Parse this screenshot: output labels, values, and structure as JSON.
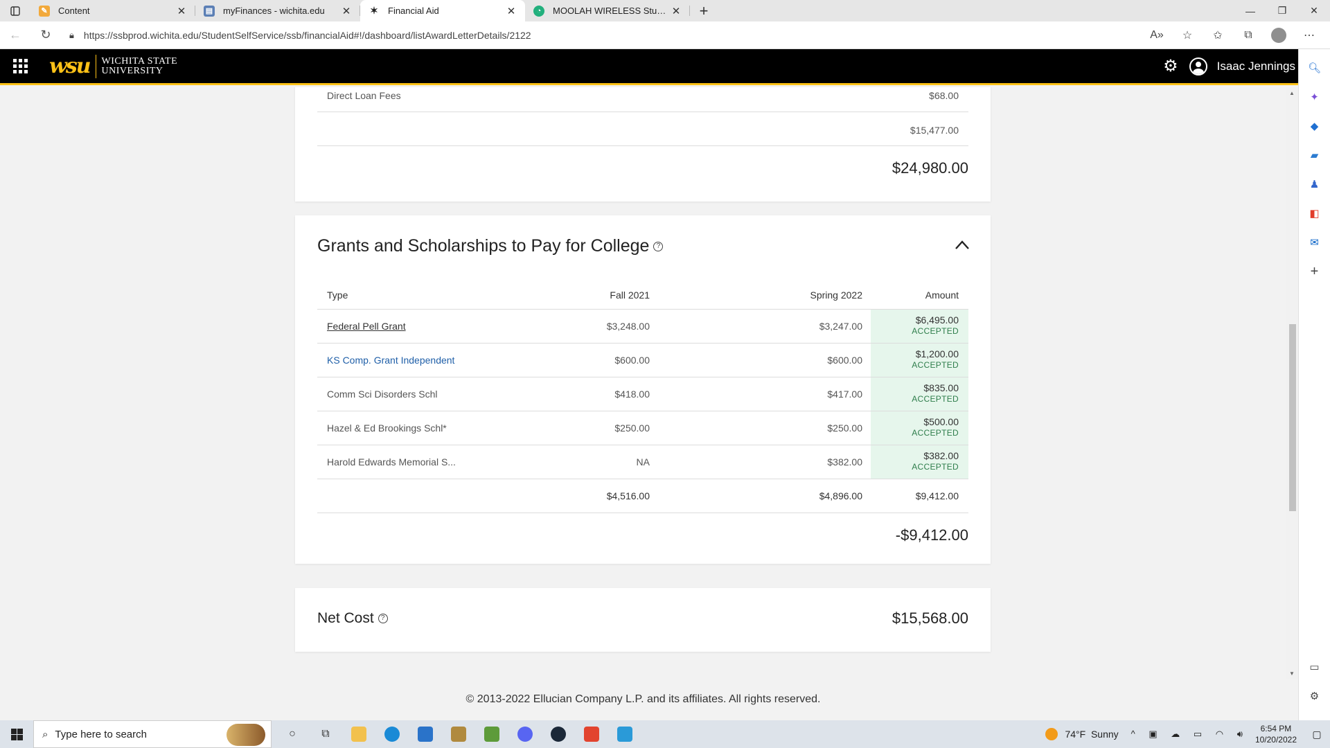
{
  "browser": {
    "tabs": [
      {
        "title": "Content",
        "favicon_color": "#f2a93b",
        "active": false
      },
      {
        "title": "myFinances - wichita.edu",
        "favicon_color": "#5b7fb5",
        "active": false
      },
      {
        "title": "Financial Aid",
        "favicon_color": "#ffc217",
        "active": true
      },
      {
        "title": "MOOLAH WIRELESS Student Tab",
        "favicon_color": "#22b07d",
        "active": false
      }
    ],
    "url": "https://ssbprod.wichita.edu/StudentSelfService/ssb/financialAid#!/dashboard/listAwardLetterDetails/2122"
  },
  "header": {
    "logo_mark": "wsu",
    "logo_line1": "Wichita State",
    "logo_line2": "University",
    "username": "Isaac Jennings"
  },
  "cost_section": {
    "direct_loan_label": "Direct Loan Fees",
    "direct_loan_amount": "$68.00",
    "subtotal": "$15,477.00",
    "total": "$24,980.00"
  },
  "grants": {
    "title": "Grants and Scholarships to Pay for College",
    "columns": {
      "type": "Type",
      "fall": "Fall 2021",
      "spring": "Spring 2022",
      "amount": "Amount"
    },
    "rows": [
      {
        "type": "Federal Pell Grant",
        "fall": "$3,248.00",
        "spring": "$3,247.00",
        "amount": "$6,495.00",
        "status": "ACCEPTED",
        "link": "underline"
      },
      {
        "type": "KS Comp. Grant Independent",
        "fall": "$600.00",
        "spring": "$600.00",
        "amount": "$1,200.00",
        "status": "ACCEPTED",
        "link": "blue"
      },
      {
        "type": "Comm Sci Disorders Schl",
        "fall": "$418.00",
        "spring": "$417.00",
        "amount": "$835.00",
        "status": "ACCEPTED",
        "link": "none"
      },
      {
        "type": "Hazel & Ed Brookings Schl*",
        "fall": "$250.00",
        "spring": "$250.00",
        "amount": "$500.00",
        "status": "ACCEPTED",
        "link": "none"
      },
      {
        "type": "Harold Edwards Memorial S...",
        "fall": "NA",
        "spring": "$382.00",
        "amount": "$382.00",
        "status": "ACCEPTED",
        "link": "none"
      }
    ],
    "totals": {
      "fall": "$4,516.00",
      "spring": "$4,896.00",
      "amount": "$9,412.00"
    },
    "net_total": "-$9,412.00"
  },
  "net_cost": {
    "label": "Net Cost",
    "value": "$15,568.00"
  },
  "footer": {
    "copyright": "© 2013-2022 Ellucian Company L.P. and its affiliates. All rights reserved."
  },
  "taskbar": {
    "search_placeholder": "Type here to search",
    "weather_temp": "74°F",
    "weather_desc": "Sunny",
    "time": "6:54 PM",
    "date": "10/20/2022"
  },
  "colors": {
    "brand_yellow": "#ffc217",
    "accepted_green": "#2e7d4b",
    "accepted_bg": "#e6f6ec",
    "link_blue": "#1f5fa8"
  }
}
